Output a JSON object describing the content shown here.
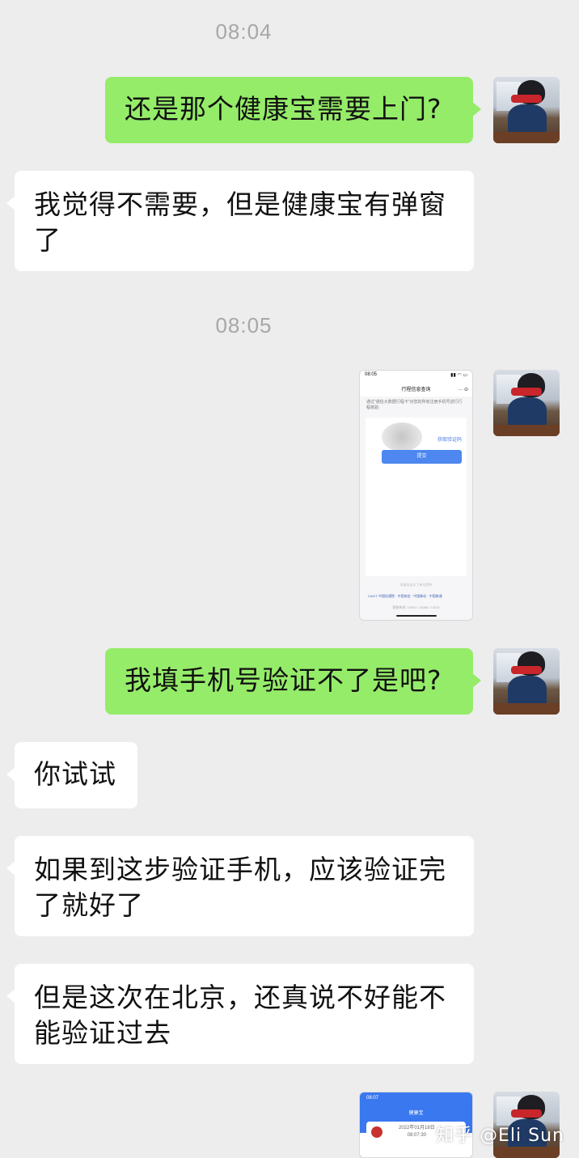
{
  "timestamps": [
    "08:04",
    "08:05"
  ],
  "messages": [
    {
      "side": "right",
      "text": "还是那个健康宝需要上门?"
    },
    {
      "side": "left",
      "text": "我觉得不需要，但是健康宝有弹窗了"
    },
    {
      "side": "right",
      "type": "image",
      "image": {
        "status_time": "08:05",
        "status_back": "< 搜索",
        "title": "行程信息查询",
        "menu": "··· ⊙",
        "desc": "通过\"通信大数据行程卡\"对您的所有注册手机号进行行程核验:",
        "get_code": "获取验证码",
        "submit": "提交",
        "footer_title": "本服务由以下单位提供",
        "footer_carriers": "CAICT 中国信通院 · 中国电信 · 中国移动 · 中国联通",
        "footer_hotline": "客服热线: 10000 / 10086 / 10010"
      }
    },
    {
      "side": "right",
      "text": "我填手机号验证不了是吧?"
    },
    {
      "side": "left",
      "text": "你试试"
    },
    {
      "side": "left",
      "text": "如果到这步验证手机，应该验证完了就好了"
    },
    {
      "side": "left",
      "text": "但是这次在北京，还真说不好能不能验证过去"
    },
    {
      "side": "right",
      "type": "image",
      "image": {
        "status_time": "08:07",
        "title": "健康宝",
        "date": "2022年01月18日",
        "time": "08:07:30"
      }
    }
  ],
  "watermark": "知乎 @Eli Sun",
  "colors": {
    "background": "#ededed",
    "bubble_self": "#95ec69",
    "bubble_other": "#ffffff",
    "timestamp": "#a7a7a7"
  }
}
